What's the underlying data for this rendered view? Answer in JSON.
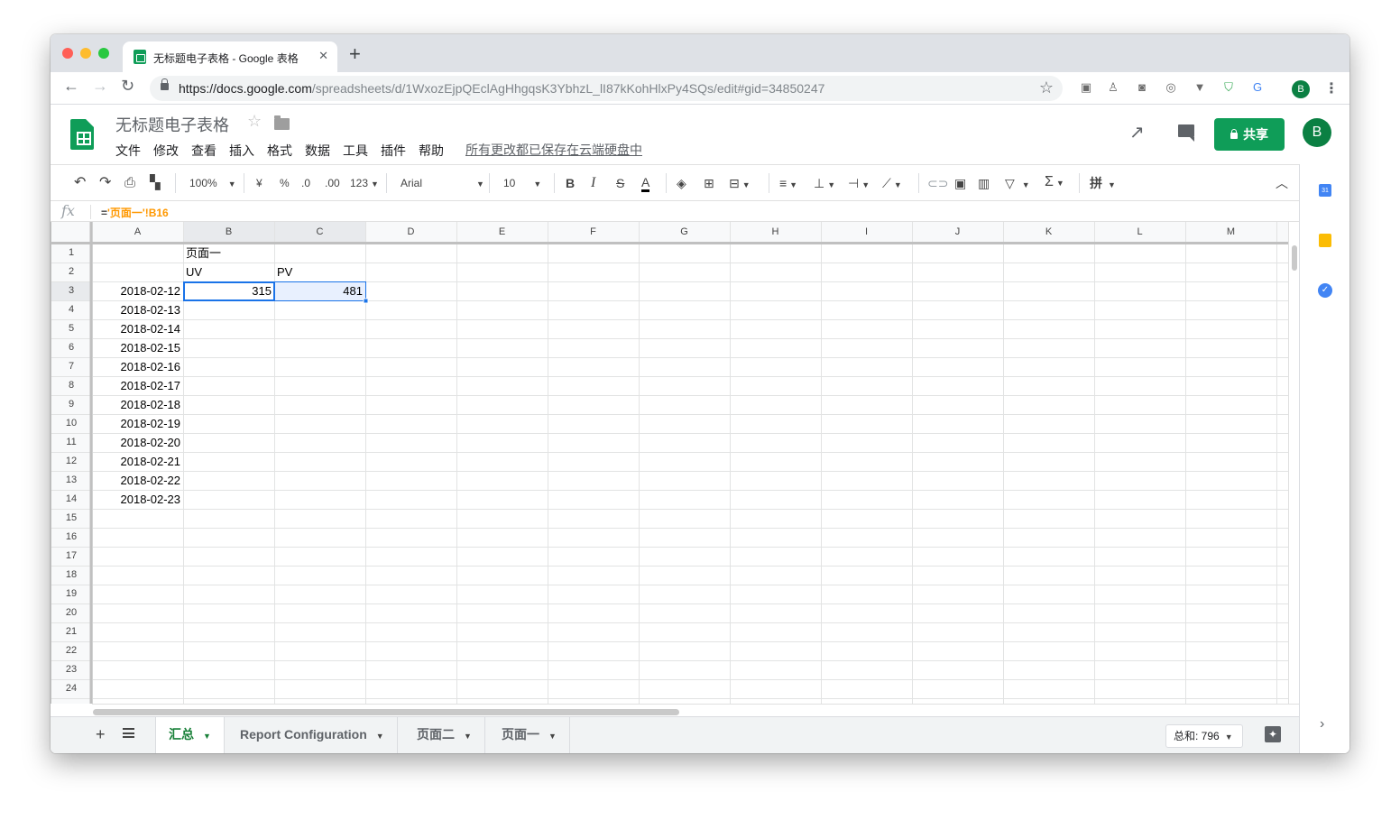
{
  "browser": {
    "tab_title": "无标题电子表格 - Google 表格",
    "url_host": "https://docs.google.com",
    "url_path": "/spreadsheets/d/1WxozEjpQEclAgHhgqsK3YbhzL_lI87kKohHlxPy4SQs/edit#gid=34850247",
    "profile_initial": "B"
  },
  "doc": {
    "title": "无标题电子表格",
    "menu": [
      "文件",
      "修改",
      "查看",
      "插入",
      "格式",
      "数据",
      "工具",
      "插件",
      "帮助"
    ],
    "save_status": "所有更改都已保存在云端硬盘中",
    "share_label": "共享",
    "avatar_initial": "B"
  },
  "toolbar": {
    "zoom": "100%",
    "currency": "¥",
    "percent": "%",
    "decrease_decimal": ".0",
    "increase_decimal": ".00",
    "more_formats": "123",
    "font": "Arial",
    "font_size": "10",
    "bold": "B",
    "italic": "I",
    "strike": "S",
    "text_color": "A",
    "sigma": "Σ",
    "input_tools": "拼"
  },
  "formula_bar": {
    "eq": "=",
    "formula": "'页面一'!B16"
  },
  "grid": {
    "columns": [
      "A",
      "B",
      "C",
      "D",
      "E",
      "F",
      "G",
      "H",
      "I",
      "J",
      "K",
      "L",
      "M"
    ],
    "rows": [
      "1",
      "2",
      "3",
      "4",
      "5",
      "6",
      "7",
      "8",
      "9",
      "10",
      "11",
      "12",
      "13",
      "14",
      "15",
      "16",
      "17",
      "18",
      "19",
      "20",
      "21",
      "22",
      "23",
      "24"
    ],
    "cells": {
      "B1": "页面一",
      "B2": "UV",
      "C2": "PV",
      "A3": "2018-02-12",
      "B3": "315",
      "C3": "481",
      "A4": "2018-02-13",
      "A5": "2018-02-14",
      "A6": "2018-02-15",
      "A7": "2018-02-16",
      "A8": "2018-02-17",
      "A9": "2018-02-18",
      "A10": "2018-02-19",
      "A11": "2018-02-20",
      "A12": "2018-02-21",
      "A13": "2018-02-22",
      "A14": "2018-02-23"
    },
    "selected_cell": "B3"
  },
  "sheets": {
    "tabs": [
      "汇总",
      "Report Configuration",
      "页面二",
      "页面一"
    ],
    "active_tab": "汇总",
    "sum_label": "总和: 796"
  },
  "side_panel": {
    "calendar_day": "31"
  },
  "colors": {
    "accent_green": "#0f9d58",
    "active_tab_green": "#188038",
    "selection_blue": "#1a73e8",
    "formula_orange": "#ff9800"
  }
}
